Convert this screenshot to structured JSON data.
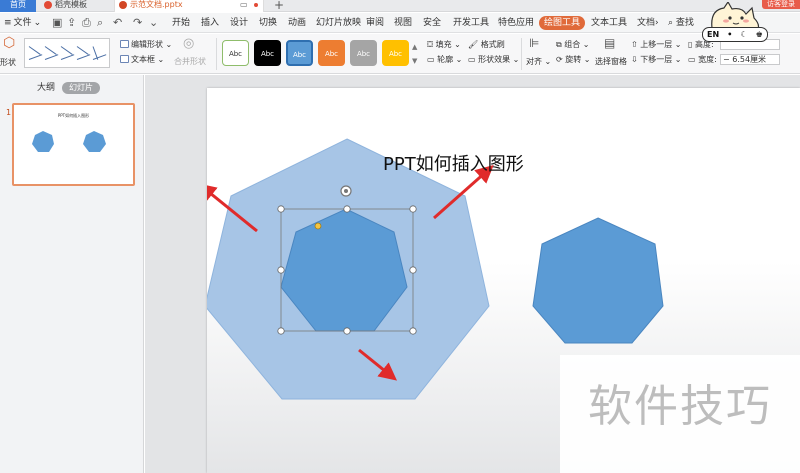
{
  "tabbar": {
    "home": "首页",
    "template": "稻壳模板",
    "document": "示范文档.pptx",
    "visitor": "访客登录"
  },
  "menubar": {
    "file": "文件",
    "items": [
      "开始",
      "插入",
      "设计",
      "切换",
      "动画",
      "幻灯片放映",
      "审阅",
      "视图",
      "安全",
      "开发工具",
      "特色应用",
      "绘图工具",
      "文本工具",
      "文档"
    ],
    "active": "绘图工具",
    "search": "查找"
  },
  "ribbon": {
    "shape_label": "形状",
    "edit_shape": "编辑形状",
    "textbox": "文本框",
    "merge_shapes": "合并形状",
    "style_labels": [
      "Abc",
      "Abc",
      "Abc",
      "Abc",
      "Abc",
      "Abc"
    ],
    "fill": "填充",
    "format_painter": "格式刷",
    "outline": "轮廓",
    "shape_effects": "形状效果",
    "align": "对齐",
    "group": "组合",
    "rotate": "旋转",
    "selection_pane": "选择窗格",
    "bring_forward": "上移一层",
    "send_backward": "下移一层",
    "height_label": "高度:",
    "width_label": "宽度:",
    "height_value": "",
    "width_value": "6.54厘米"
  },
  "sticker": {
    "lang": "EN",
    "marks": [
      "•",
      "›"
    ]
  },
  "leftpane": {
    "outline_tab": "大纲",
    "slides_tab": "幻灯片",
    "slide_number": "1",
    "thumb_title": "PPT如何插入图形"
  },
  "slide": {
    "title": "PPT如何插入图形"
  },
  "watermark": "软件技巧",
  "colors": {
    "accent": "#e06a3a",
    "shape_fill": "#5b9bd5",
    "shape_fill_light": "#a7c5e6",
    "arrow_red": "#e02b2b",
    "home_tab": "#3a7bd5"
  }
}
